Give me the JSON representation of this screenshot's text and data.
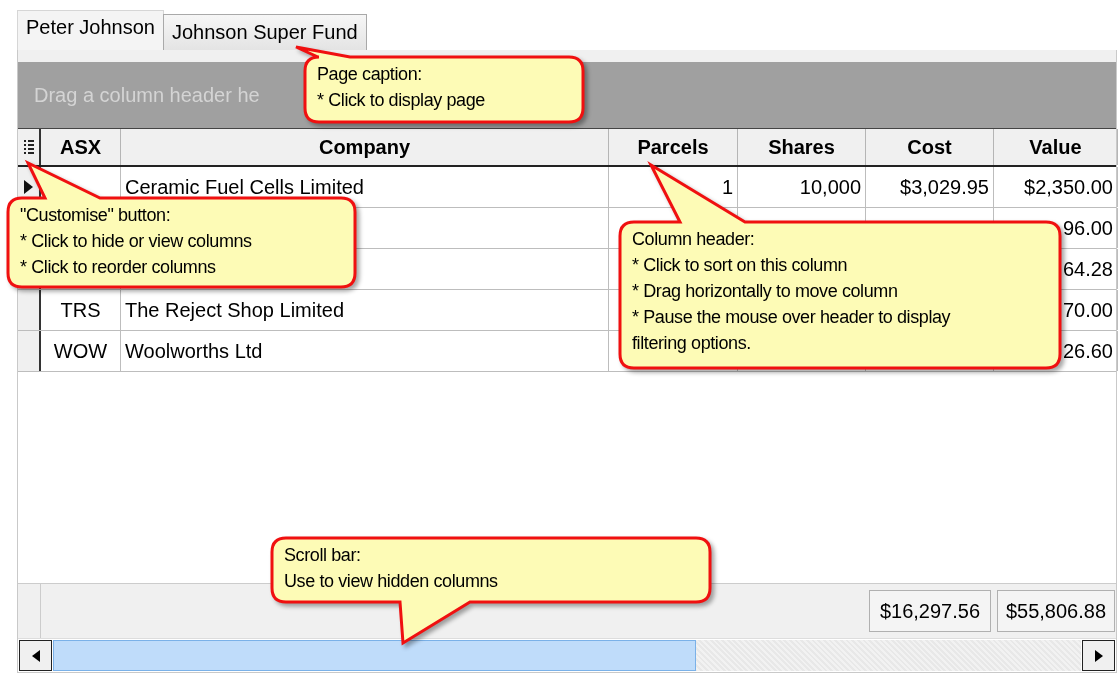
{
  "tabs": [
    {
      "label": "Peter Johnson",
      "selected": true
    },
    {
      "label": "Johnson Super Fund",
      "selected": false
    }
  ],
  "group_panel": {
    "text": "Drag a column header he"
  },
  "columns": [
    "ASX",
    "Company",
    "Parcels",
    "Shares",
    "Cost",
    "Value"
  ],
  "rows": [
    {
      "selected": true,
      "company": "Ceramic Fuel Cells Limited",
      "parcels": "1",
      "shares": "10,000",
      "cost": "$3,029.95",
      "value": "$2,350.00"
    },
    {
      "value": "96.00"
    },
    {
      "value": "64.28"
    },
    {
      "selected": false,
      "asx": "TRS",
      "company": "The Reject Shop Limited",
      "value": "70.00"
    },
    {
      "selected": false,
      "asx": "WOW",
      "company": "Woolworths Ltd",
      "value": "26.60"
    }
  ],
  "totals": {
    "cost": "$16,297.56",
    "value": "$55,806.88"
  },
  "callouts": [
    {
      "lines": [
        "Page caption:",
        "* Click to display page"
      ]
    },
    {
      "lines": [
        "\"Customise\" button:",
        "* Click to hide or view columns",
        "* Click to reorder columns"
      ]
    },
    {
      "lines": [
        "Column header:",
        "* Click to sort on this column",
        "* Drag horizontally to move column",
        "* Pause the mouse over header to display",
        "filtering options."
      ]
    },
    {
      "lines": [
        "Scroll bar:",
        "Use to view hidden columns"
      ]
    }
  ]
}
